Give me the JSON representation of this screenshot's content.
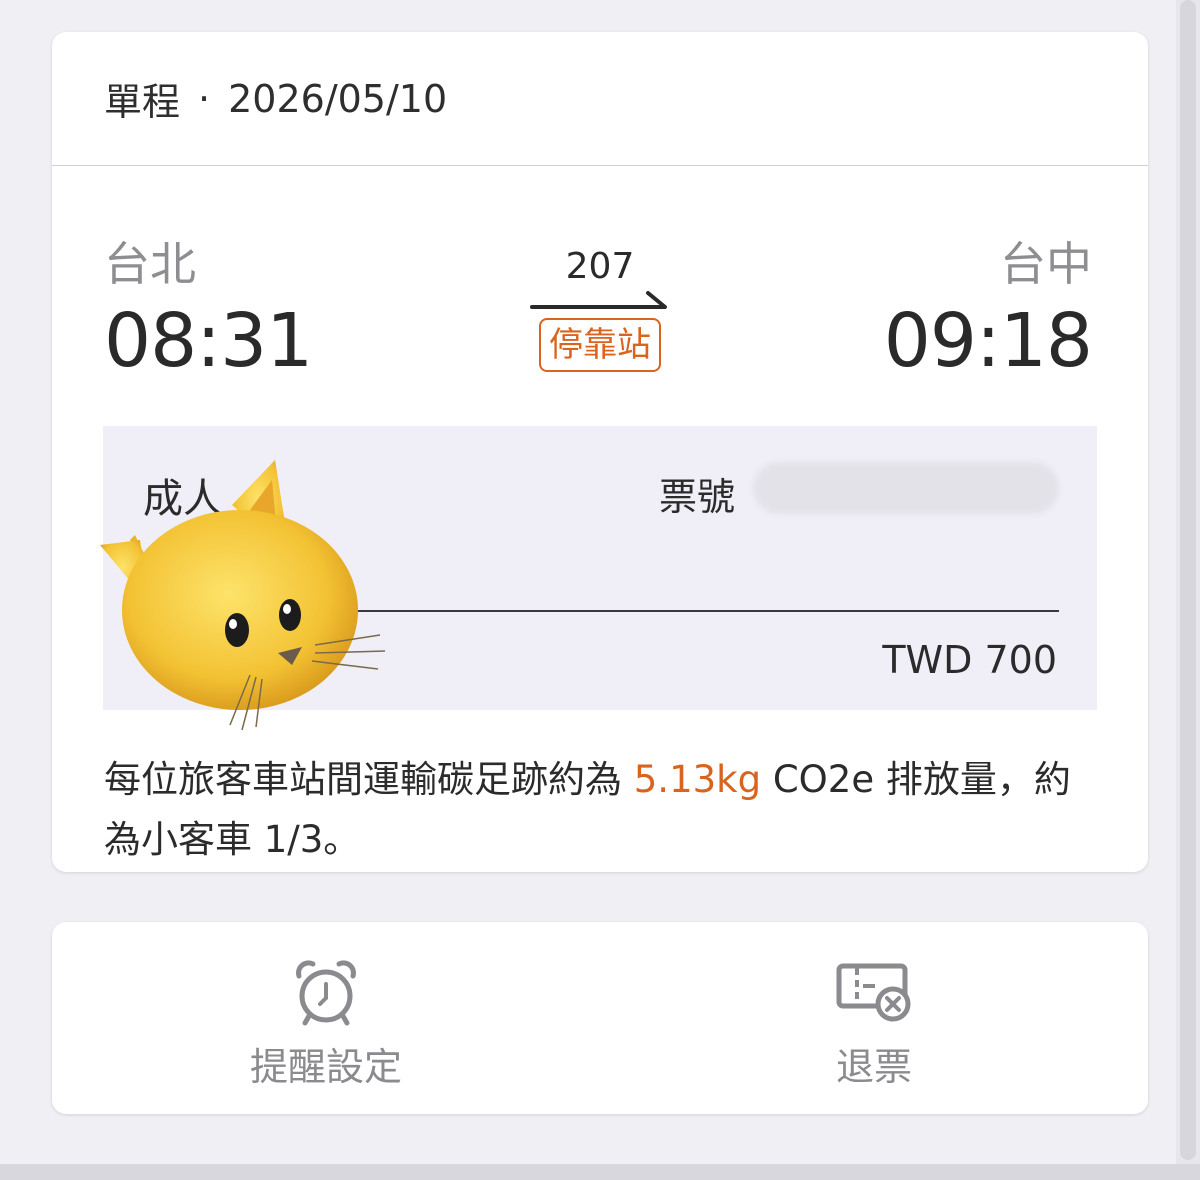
{
  "header": {
    "trip_type": "單程",
    "separator": "·",
    "date": "2026/05/10"
  },
  "route": {
    "origin": {
      "station": "台北",
      "time": "08:31"
    },
    "destination": {
      "station": "台中",
      "time": "09:18"
    },
    "train_no": "207",
    "stop_badge": "停靠站"
  },
  "fare": {
    "passenger_type": "成人",
    "ticket_no_label": "票號",
    "ticket_no_value": "",
    "amount": "TWD 700"
  },
  "carbon": {
    "prefix": "每位旅客車站間運輸碳足跡約為 ",
    "value": "5.13kg",
    "suffix": " CO2e 排放量，約為小客車 1/3。"
  },
  "actions": {
    "reminder_label": "提醒設定",
    "refund_label": "退票"
  },
  "icons": {
    "reminder": "alarm-clock-icon",
    "refund": "ticket-cancel-icon",
    "sticker": "cat-face-icon"
  },
  "colors": {
    "accent": "#d9641e",
    "background": "#f0eff4",
    "fare_box": "#f0eff7",
    "muted_text": "#8a8a8f"
  }
}
